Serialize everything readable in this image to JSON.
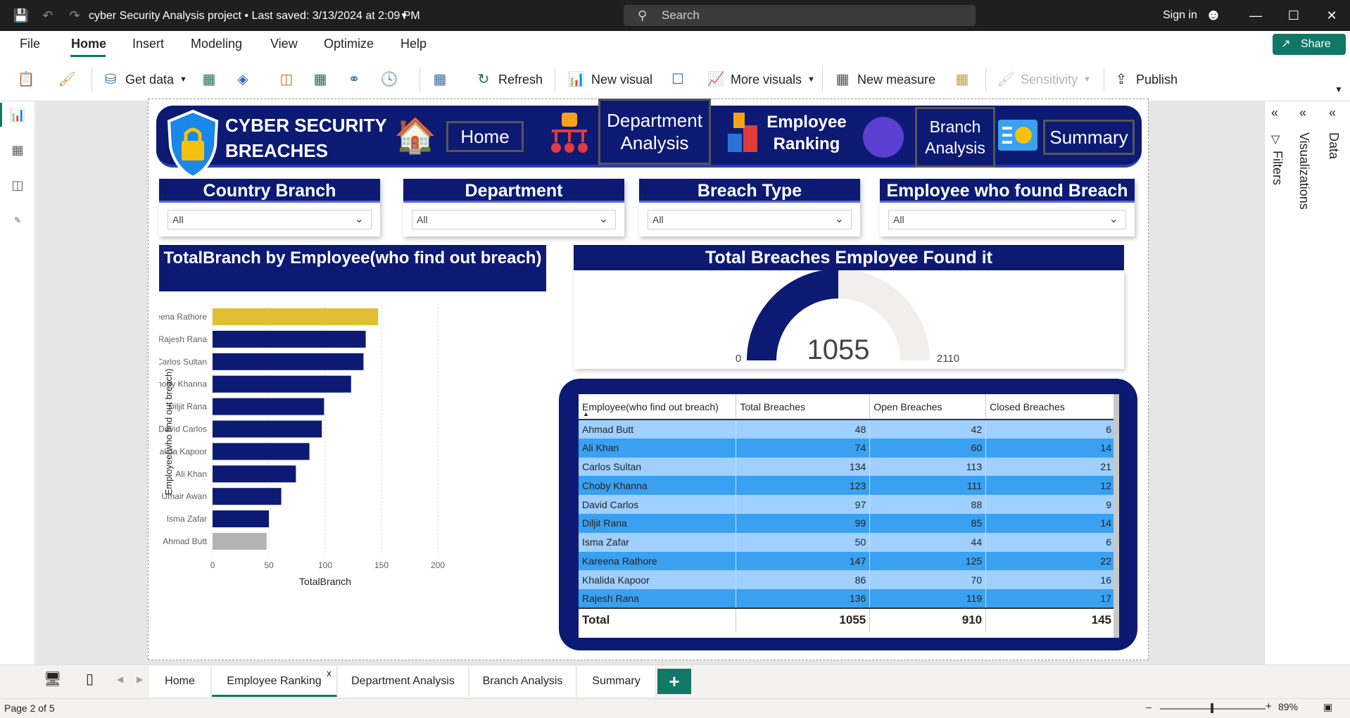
{
  "titlebar": {
    "title": "cyber Security Analysis project • Last saved: 3/13/2024 at 2:09 PM",
    "search_placeholder": "Search",
    "signin": "Sign in"
  },
  "menu": {
    "items": [
      "File",
      "Home",
      "Insert",
      "Modeling",
      "View",
      "Optimize",
      "Help"
    ],
    "active": "Home",
    "share": "Share"
  },
  "ribbon": {
    "get_data": "Get data",
    "refresh": "Refresh",
    "new_visual": "New visual",
    "more_visuals": "More visuals",
    "new_measure": "New measure",
    "sensitivity": "Sensitivity",
    "publish": "Publish"
  },
  "banner": {
    "title": "CYBER SECURITY BREACHES",
    "nav": {
      "home": "Home",
      "department": "Department Analysis",
      "employee_ranking": "Employee Ranking",
      "branch": "Branch Analysis",
      "summary": "Summary"
    }
  },
  "slicers": [
    {
      "title": "Country Branch",
      "value": "All"
    },
    {
      "title": "Department",
      "value": "All"
    },
    {
      "title": "Breach Type",
      "value": "All"
    },
    {
      "title": "Employee who found Breach",
      "value": "All"
    }
  ],
  "chart_data": [
    {
      "type": "bar",
      "orientation": "horizontal",
      "title": "TotalBranch by Employee(who find out breach)",
      "xlabel": "TotalBranch",
      "ylabel": "Employee(who find out breach)",
      "categories": [
        "Kareena Rathore",
        "Rajesh Rana",
        "Carlos Sultan",
        "Choby Khanna",
        "Diljit Rana",
        "David Carlos",
        "Khalida Kapoor",
        "Ali Khan",
        "Umair Awan",
        "Isma Zafar",
        "Ahmad Butt"
      ],
      "values": [
        147,
        136,
        134,
        123,
        99,
        97,
        86,
        74,
        61,
        50,
        48
      ],
      "xlim": [
        0,
        200
      ],
      "xticks": [
        0,
        50,
        100,
        150,
        200
      ],
      "colors": {
        "default": "#0d1a73",
        "highest": "#e0c030",
        "lowest": "#b3b3b3"
      },
      "grid": true
    },
    {
      "type": "gauge",
      "title": "Total Breaches Employee Found it",
      "value": 1055,
      "min": 0,
      "max": 2110,
      "colors": {
        "fill": "#0d1a73",
        "track": "#f0efee"
      }
    }
  ],
  "table": {
    "columns": [
      "Employee(who find out breach)",
      "Total Breaches",
      "Open Breaches",
      "Closed Breaches"
    ],
    "rows": [
      [
        "Ahmad Butt",
        "48",
        "42",
        "6"
      ],
      [
        "Ali Khan",
        "74",
        "60",
        "14"
      ],
      [
        "Carlos Sultan",
        "134",
        "113",
        "21"
      ],
      [
        "Choby Khanna",
        "123",
        "111",
        "12"
      ],
      [
        "David Carlos",
        "97",
        "88",
        "9"
      ],
      [
        "Diljit Rana",
        "99",
        "85",
        "14"
      ],
      [
        "Isma Zafar",
        "50",
        "44",
        "6"
      ],
      [
        "Kareena Rathore",
        "147",
        "125",
        "22"
      ],
      [
        "Khalida Kapoor",
        "86",
        "70",
        "16"
      ],
      [
        "Rajesh Rana",
        "136",
        "119",
        "17"
      ]
    ],
    "total": [
      "Total",
      "1055",
      "910",
      "145"
    ]
  },
  "panes": {
    "filters": "Filters",
    "visualizations": "Visualizations",
    "data": "Data"
  },
  "pages": {
    "tabs": [
      "Home",
      "Employee Ranking",
      "Department Analysis",
      "Branch Analysis",
      "Summary"
    ],
    "active": "Employee Ranking",
    "add": "+",
    "close": "x"
  },
  "status": {
    "page_info": "Page 2 of 5",
    "zoom": "89%"
  }
}
